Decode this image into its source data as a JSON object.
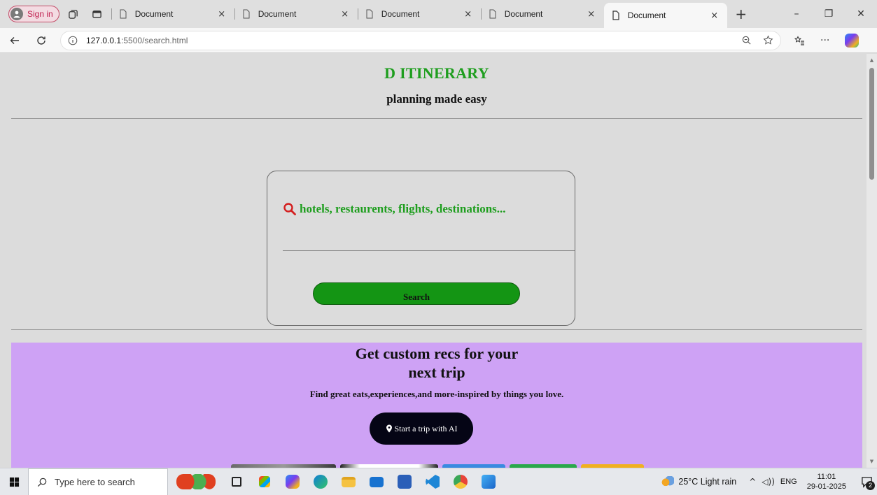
{
  "browser": {
    "signin_label": "Sign in",
    "tabs": [
      {
        "title": "Document",
        "active": false
      },
      {
        "title": "Document",
        "active": false
      },
      {
        "title": "Document",
        "active": false
      },
      {
        "title": "Document",
        "active": false
      },
      {
        "title": "Document",
        "active": true
      }
    ],
    "tab_close_glyph": "×",
    "new_tab_glyph": "+",
    "window_controls": {
      "minimize": "–",
      "restore": "❐",
      "close": "✕"
    },
    "url_host": "127.0.0.1",
    "url_path": ":5500/search.html",
    "more_glyph": "···"
  },
  "page": {
    "brand": "D ITINERARY",
    "tagline": "planning made easy",
    "search": {
      "placeholder": "hotels, restaurents, flights, destinations...",
      "button_label": "Search"
    },
    "promo": {
      "title": "Get custom recs for your next trip",
      "subtitle": "Find great eats,experiences,and more-inspired by things you love.",
      "button_label": "Start a trip with AI"
    }
  },
  "taskbar": {
    "search_placeholder": "Type here to search",
    "weather": "25°C  Light rain",
    "language": "ENG",
    "time": "11:01",
    "date": "29-01-2025",
    "notification_count": "2"
  },
  "colors": {
    "brand_green": "#1e9e1e",
    "search_icon_red": "#d42020",
    "button_green": "#149514",
    "promo_purple": "#cea2f5",
    "ai_button": "#050515"
  },
  "icons": {
    "search": "magnifier-icon",
    "location": "map-pin-icon"
  }
}
